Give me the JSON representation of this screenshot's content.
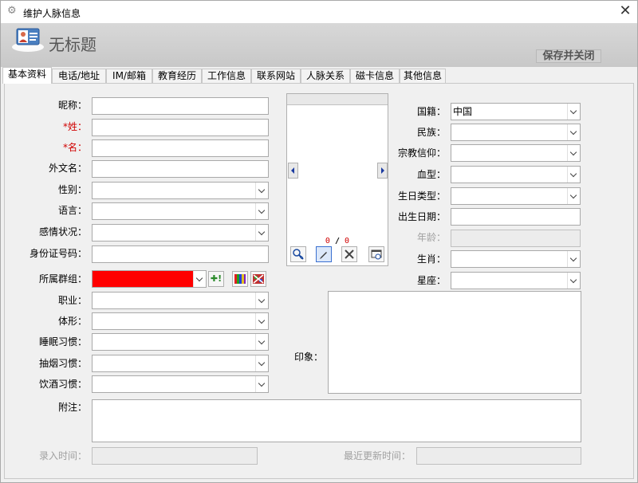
{
  "window": {
    "title": "维护人脉信息",
    "close_glyph": "✕"
  },
  "header": {
    "doc_title": "无标题",
    "save_close": "保存并关闭"
  },
  "tabs": [
    "基本资料",
    "电话/地址",
    "IM/邮箱",
    "教育经历",
    "工作信息",
    "联系网站",
    "人脉关系",
    "磁卡信息",
    "其他信息"
  ],
  "left": {
    "nickname": "昵称：",
    "surname": "*姓：",
    "given_name": "*名：",
    "foreign_name": "外文名：",
    "gender": "性别：",
    "language": "语言：",
    "marital": "感情状况：",
    "id_number": "身份证号码：",
    "group": "所属群组：",
    "group_color": "#ff0000",
    "occupation": "职业：",
    "body_type": "体形：",
    "sleep": "睡眠习惯：",
    "smoking": "抽烟习惯：",
    "drinking": "饮酒习惯："
  },
  "photo": {
    "counter_current": "0",
    "counter_sep": "/",
    "counter_total": "0"
  },
  "right": {
    "nationality": "国籍：",
    "nationality_value": "中国",
    "ethnicity": "民族：",
    "religion": "宗教信仰：",
    "blood": "血型：",
    "birthday_type": "生日类型：",
    "birth_date": "出生日期：",
    "age": "年龄：",
    "zodiac": "生肖：",
    "constellation": "星座："
  },
  "impression": "印象：",
  "note": "附注：",
  "entry_time": "录入时间：",
  "last_update": "最近更新时间："
}
